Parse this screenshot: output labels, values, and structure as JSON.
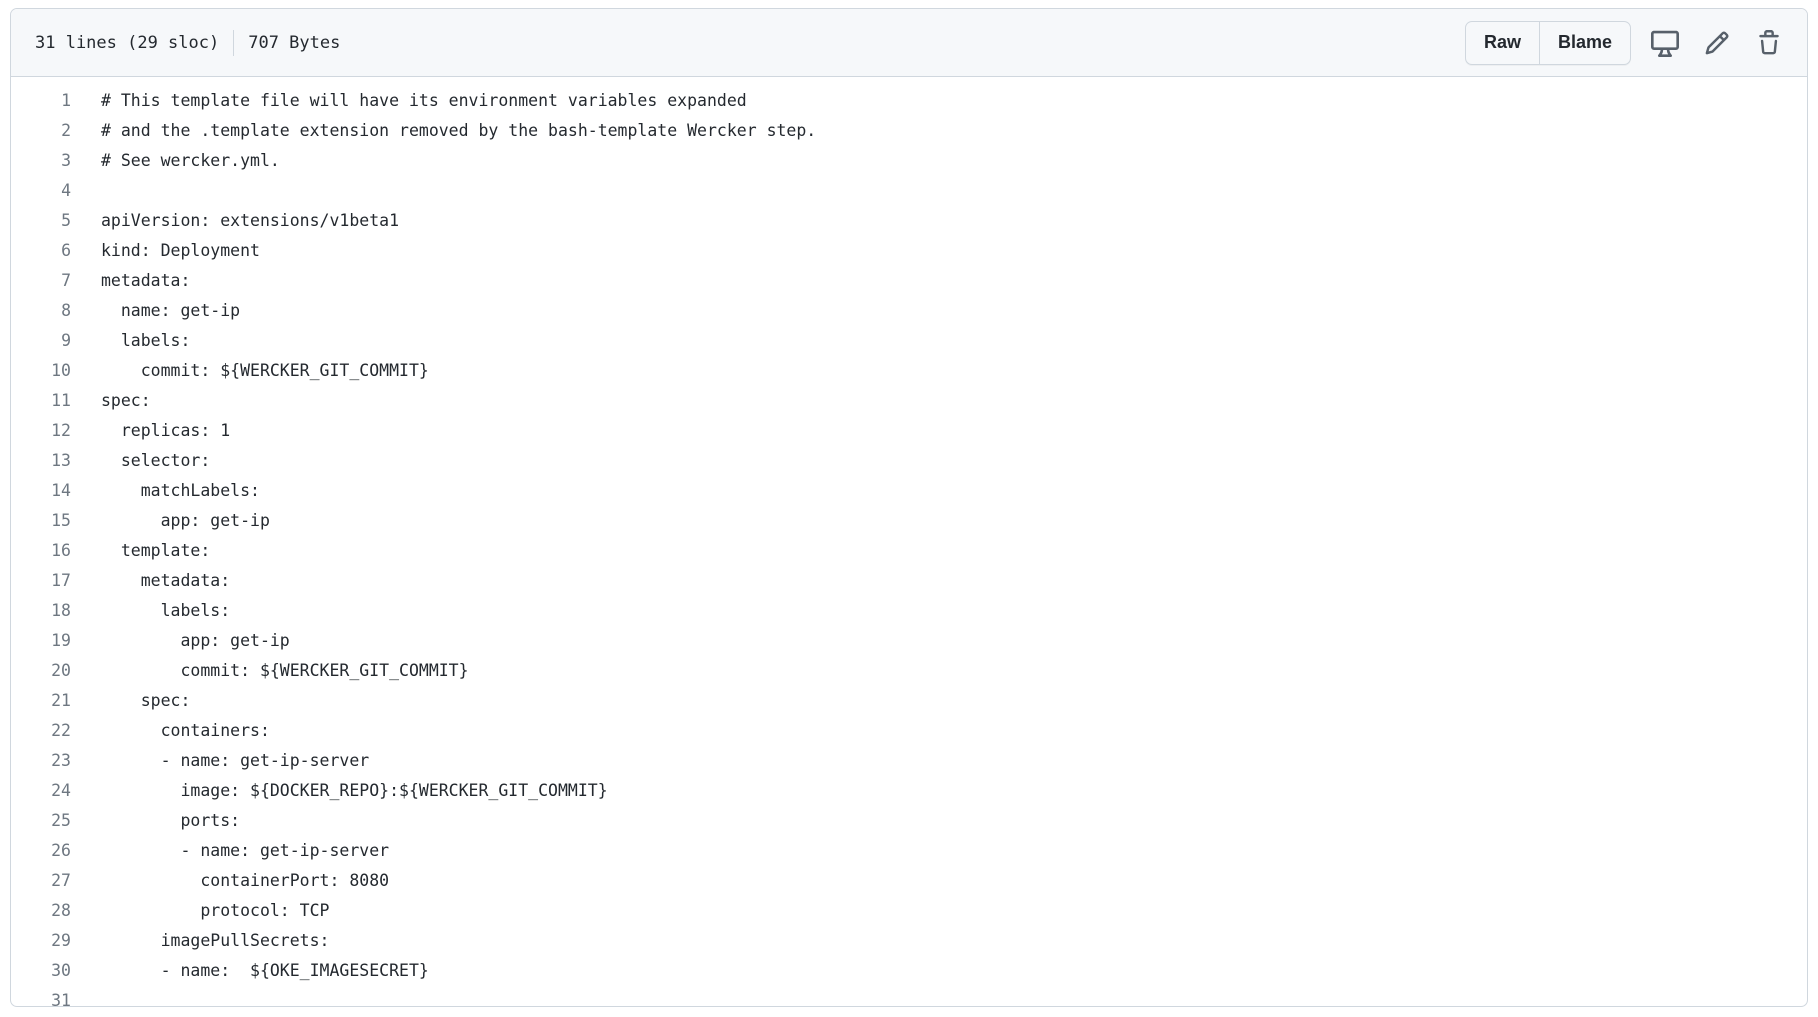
{
  "file_info": {
    "lines": "31 lines (29 sloc)",
    "size": "707 Bytes"
  },
  "actions": {
    "raw_label": "Raw",
    "blame_label": "Blame",
    "icons": [
      "desktop-icon",
      "pencil-icon",
      "trash-icon"
    ]
  },
  "code_lines": [
    {
      "n": "1",
      "text": "# This template file will have its environment variables expanded"
    },
    {
      "n": "2",
      "text": "# and the .template extension removed by the bash-template Wercker step."
    },
    {
      "n": "3",
      "text": "# See wercker.yml."
    },
    {
      "n": "4",
      "text": ""
    },
    {
      "n": "5",
      "text": "apiVersion: extensions/v1beta1"
    },
    {
      "n": "6",
      "text": "kind: Deployment"
    },
    {
      "n": "7",
      "text": "metadata:"
    },
    {
      "n": "8",
      "text": "  name: get-ip"
    },
    {
      "n": "9",
      "text": "  labels:"
    },
    {
      "n": "10",
      "text": "    commit: ${WERCKER_GIT_COMMIT}"
    },
    {
      "n": "11",
      "text": "spec:"
    },
    {
      "n": "12",
      "text": "  replicas: 1"
    },
    {
      "n": "13",
      "text": "  selector:"
    },
    {
      "n": "14",
      "text": "    matchLabels:"
    },
    {
      "n": "15",
      "text": "      app: get-ip"
    },
    {
      "n": "16",
      "text": "  template:"
    },
    {
      "n": "17",
      "text": "    metadata:"
    },
    {
      "n": "18",
      "text": "      labels:"
    },
    {
      "n": "19",
      "text": "        app: get-ip"
    },
    {
      "n": "20",
      "text": "        commit: ${WERCKER_GIT_COMMIT}"
    },
    {
      "n": "21",
      "text": "    spec:"
    },
    {
      "n": "22",
      "text": "      containers:"
    },
    {
      "n": "23",
      "text": "      - name: get-ip-server"
    },
    {
      "n": "24",
      "text": "        image: ${DOCKER_REPO}:${WERCKER_GIT_COMMIT}"
    },
    {
      "n": "25",
      "text": "        ports:"
    },
    {
      "n": "26",
      "text": "        - name: get-ip-server"
    },
    {
      "n": "27",
      "text": "          containerPort: 8080"
    },
    {
      "n": "28",
      "text": "          protocol: TCP"
    },
    {
      "n": "29",
      "text": "      imagePullSecrets:"
    },
    {
      "n": "30",
      "text": "      - name:  ${OKE_IMAGESECRET}"
    },
    {
      "n": "31",
      "text": ""
    }
  ]
}
